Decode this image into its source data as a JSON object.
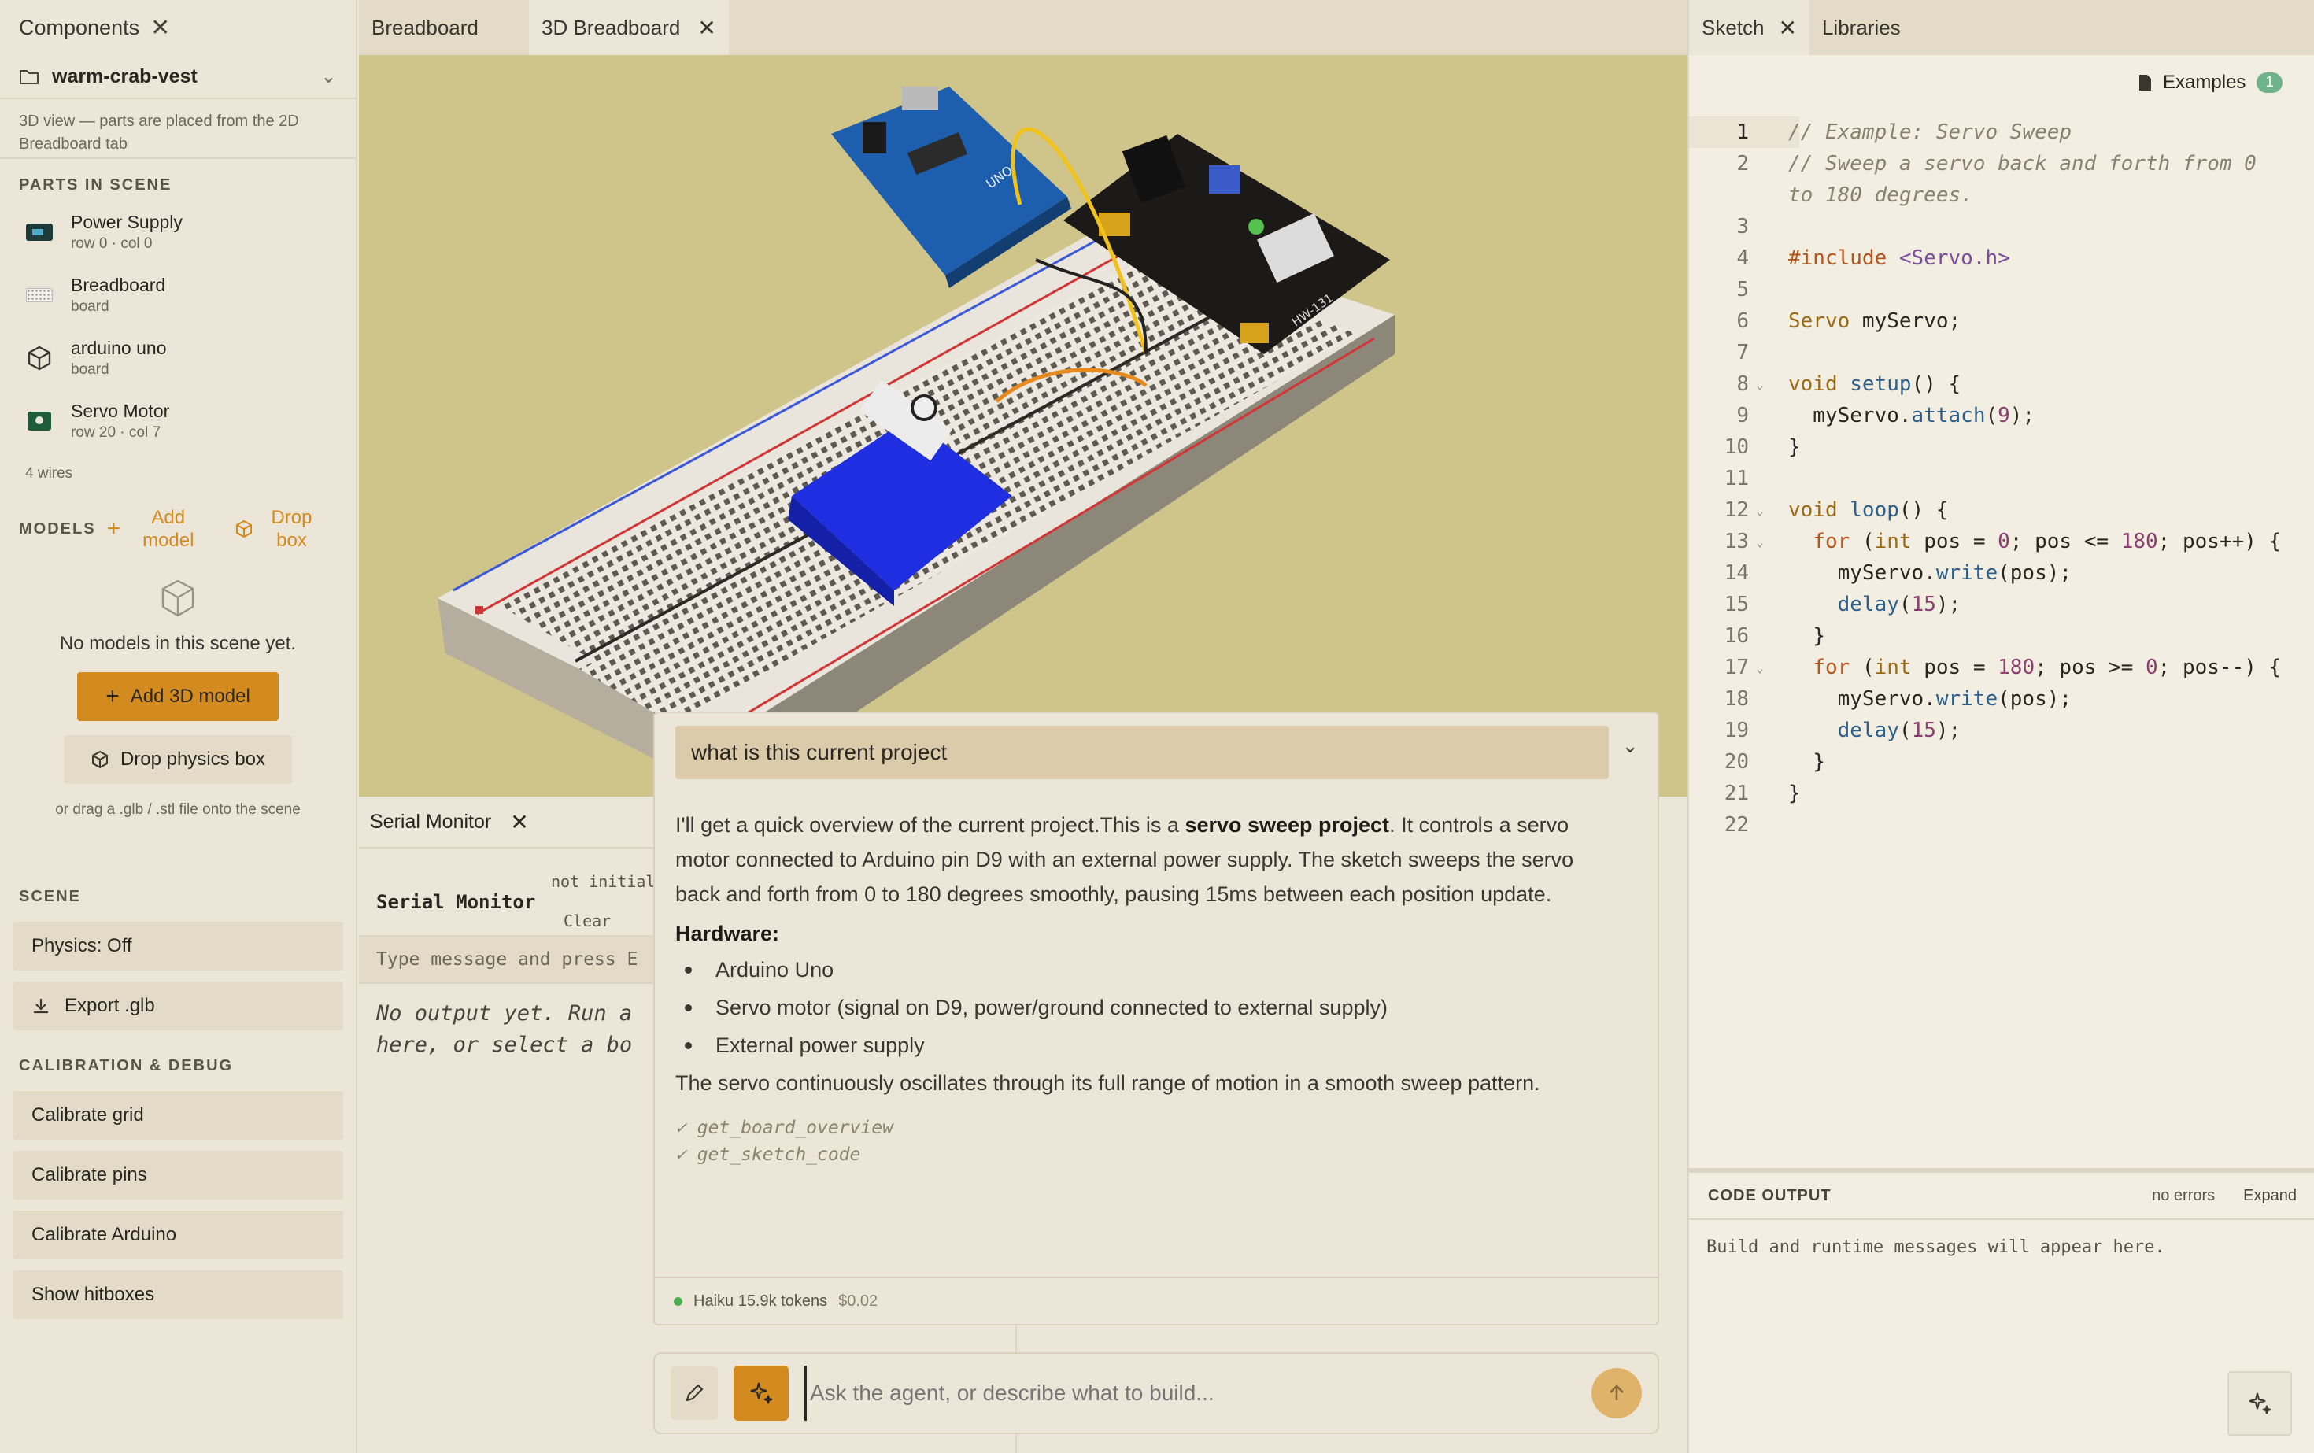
{
  "left": {
    "tab_label": "Components",
    "project_name": "warm-crab-vest",
    "note": "3D view — parts are placed from the 2D Breadboard tab",
    "parts_heading": "PARTS IN SCENE",
    "parts": [
      {
        "name": "Power Supply",
        "sub": "row 0 · col 0"
      },
      {
        "name": "Breadboard",
        "sub": "board"
      },
      {
        "name": "arduino uno",
        "sub": "board"
      },
      {
        "name": "Servo Motor",
        "sub": "row 20 · col 7"
      }
    ],
    "wires": "4 wires",
    "models_heading": "MODELS",
    "add_model": [
      "Add",
      "model"
    ],
    "drop_box": [
      "Drop",
      "box"
    ],
    "empty_text": "No models in this scene yet.",
    "add_3d_model": "Add 3D model",
    "drop_physics_box": "Drop physics box",
    "drag_hint": "or drag a .glb / .stl file onto the scene",
    "scene_heading": "SCENE",
    "physics": "Physics: Off",
    "export": "Export .glb",
    "calib_heading": "CALIBRATION & DEBUG",
    "calib_grid": "Calibrate grid",
    "calib_pins": "Calibrate pins",
    "calib_arduino": "Calibrate Arduino",
    "show_hitboxes": "Show hitboxes"
  },
  "center": {
    "tabs": [
      "Breadboard",
      "3D Breadboard"
    ],
    "board_labels": {
      "uno": "UNO",
      "psu": "HW-131"
    }
  },
  "serial": {
    "tab": "Serial Monitor",
    "title": "Serial Monitor",
    "status": "not initial",
    "clear": "Clear",
    "input_placeholder": "Type message and press E",
    "empty_line1": "No output yet. Run a",
    "empty_line2": "here, or select a bo"
  },
  "chat": {
    "question": "what is this current project",
    "intro_plain": "I'll get a quick overview of the current project.This is a ",
    "intro_bold": "servo sweep project",
    "intro_rest": ". It controls a servo motor connected to Arduino pin D9 with an external power supply. The sketch sweeps the servo back and forth from 0 to 180 degrees smoothly, pausing 15ms between each position update.",
    "hardware_heading": "Hardware:",
    "hardware": [
      "Arduino Uno",
      "Servo motor (signal on D9, power/ground connected to external supply)",
      "External power supply"
    ],
    "outro": "The servo continuously oscillates through its full range of motion in a smooth sweep pattern.",
    "tools": [
      "✓ get_board_overview",
      "✓ get_sketch_code"
    ],
    "model_usage": "Haiku 15.9k tokens",
    "cost": "$0.02",
    "prompt_placeholder": "Ask the agent, or describe what to build..."
  },
  "right": {
    "tabs": [
      "Sketch",
      "Libraries"
    ],
    "examples": "Examples",
    "examples_count": "1",
    "code_output": "CODE OUTPUT",
    "no_errors": "no errors",
    "expand": "Expand",
    "output_msg": "Build and runtime messages will appear here."
  },
  "colors": {
    "accent": "#d38a1e",
    "status_green": "#4caf50",
    "badge": "#6fb38a"
  }
}
